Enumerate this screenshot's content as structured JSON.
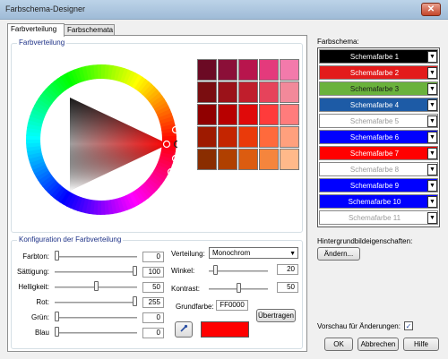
{
  "window": {
    "title": "Farbschema-Designer",
    "close_glyph": "✕"
  },
  "tabs": [
    {
      "label": "Farbverteilung",
      "active": true
    },
    {
      "label": "Farbschemata",
      "active": false
    }
  ],
  "distribution": {
    "legend": "Farbverteilung"
  },
  "swatch_colors": [
    "#6b0a24",
    "#8b0f38",
    "#b8154d",
    "#e43a7c",
    "#f37aab",
    "#7a0d10",
    "#9b1219",
    "#c01e2c",
    "#e6435b",
    "#f2899a",
    "#900000",
    "#b80000",
    "#e00a0a",
    "#ff3b3b",
    "#ff7c7c",
    "#9e1a00",
    "#c42500",
    "#ea3a0a",
    "#ff6a3c",
    "#ffa07d",
    "#8a2d00",
    "#b04000",
    "#dc5c10",
    "#f5853d",
    "#ffb98a"
  ],
  "config": {
    "legend": "Konfiguration der Farbverteilung",
    "sliders": [
      {
        "label": "Farbton:",
        "value": "0",
        "level": 0.0
      },
      {
        "label": "Sättigung:",
        "value": "100",
        "level": 1.0
      },
      {
        "label": "Helligkeit:",
        "value": "50",
        "level": 0.5
      },
      {
        "label": "Rot:",
        "value": "255",
        "level": 1.0
      },
      {
        "label": "Grün:",
        "value": "0",
        "level": 0.0
      },
      {
        "label": "Blau",
        "value": "0",
        "level": 0.0
      }
    ],
    "verteilung_label": "Verteilung:",
    "verteilung_value": "Monochrom",
    "winkel_label": "Winkel:",
    "winkel_value": "20",
    "winkel_level": 0.08,
    "kontrast_label": "Kontrast:",
    "kontrast_value": "50",
    "kontrast_level": 0.5,
    "grundfarbe_label": "Grundfarbe:",
    "grundfarbe_value": "FF0000",
    "uebertragen_label": "Übertragen",
    "preview_color": "#ff0000"
  },
  "schema": {
    "label": "Farbschema:",
    "items": [
      {
        "name": "Schemafarbe 1",
        "bg": "#000000",
        "fg": "#ffffff"
      },
      {
        "name": "Schemafarbe 2",
        "bg": "#e31b1b",
        "fg": "#ffffff"
      },
      {
        "name": "Schemafarbe 3",
        "bg": "#6ab23c",
        "fg": "#1a1a1a"
      },
      {
        "name": "Schemafarbe 4",
        "bg": "#1d5ba6",
        "fg": "#ffffff"
      },
      {
        "name": "Schemafarbe 5",
        "bg": "#ffffff",
        "fg": "#9a9a9a"
      },
      {
        "name": "Schemafarbe 6",
        "bg": "#0000ff",
        "fg": "#ffffff"
      },
      {
        "name": "Schemafarbe 7",
        "bg": "#ff0000",
        "fg": "#ffffff"
      },
      {
        "name": "Schemafarbe 8",
        "bg": "#ffffff",
        "fg": "#9a9a9a"
      },
      {
        "name": "Schemafarbe 9",
        "bg": "#0000ff",
        "fg": "#ffffff"
      },
      {
        "name": "Schemafarbe 10",
        "bg": "#0000ff",
        "fg": "#ffffff"
      },
      {
        "name": "Schemafarbe 11",
        "bg": "#ffffff",
        "fg": "#9a9a9a"
      }
    ],
    "dropdown_glyph": "▼"
  },
  "background_props": {
    "label": "Hintergrundbildeigenschaften:",
    "button": "Ändern..."
  },
  "preview_changes": {
    "label": "Vorschau für Änderungen:",
    "checked": true,
    "check_glyph": "✓"
  },
  "footer": {
    "ok": "OK",
    "cancel": "Abbrechen",
    "help": "Hilfe"
  }
}
